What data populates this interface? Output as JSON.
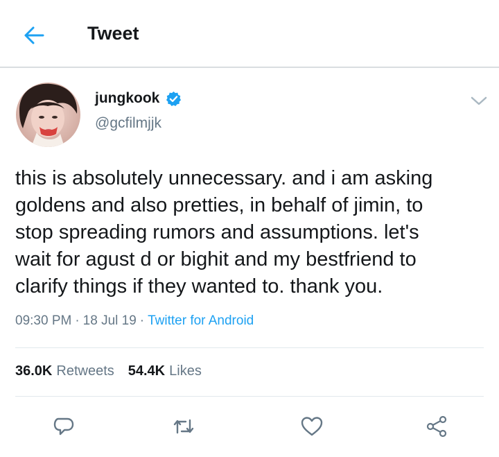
{
  "header": {
    "title": "Tweet",
    "back_icon": "back-arrow-icon"
  },
  "colors": {
    "accent": "#1da1f2",
    "text": "#14171a",
    "secondary": "#657786",
    "divider": "#e1e8ed"
  },
  "tweet": {
    "author": {
      "display_name": "jungkook",
      "handle": "@gcfilmjjk",
      "verified": true,
      "avatar_icon": "avatar"
    },
    "text": "this is absolutely unnecessary. and i am asking\ngoldens and also pretties, in behalf of jimin, to\nstop spreading rumors and assumptions. let's\nwait for agust d or bighit and my bestfriend to\nclarify things if they wanted to. thank you.",
    "time": "09:30 PM",
    "separator": "·",
    "date": "18 Jul 19",
    "source": "Twitter for Android"
  },
  "stats": {
    "retweets_count": "36.0K",
    "retweets_label": "Retweets",
    "likes_count": "54.4K",
    "likes_label": "Likes"
  },
  "actions": [
    {
      "icon": "reply-icon"
    },
    {
      "icon": "retweet-icon"
    },
    {
      "icon": "like-icon"
    },
    {
      "icon": "share-icon"
    }
  ]
}
